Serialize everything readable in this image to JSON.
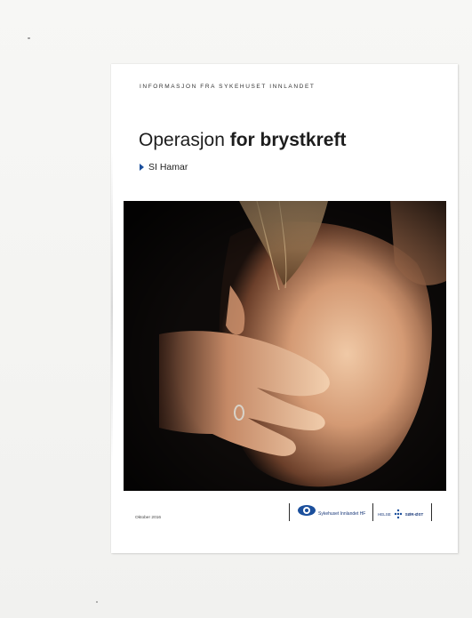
{
  "brochure": {
    "kicker": "INFORMASJON FRA SYKEHUSET INNLANDET",
    "title_light": "Operasjon",
    "title_bold": "for brystkreft",
    "location": "SI Hamar",
    "date": "Oktober 2016",
    "logo_primary": "Sykehuset Innlandet HF",
    "logo_secondary_left": "HELSE",
    "logo_secondary_right": "SØR-ØST"
  },
  "colors": {
    "accent_blue": "#1b4f9c",
    "text_dark": "#1d1d1d"
  }
}
